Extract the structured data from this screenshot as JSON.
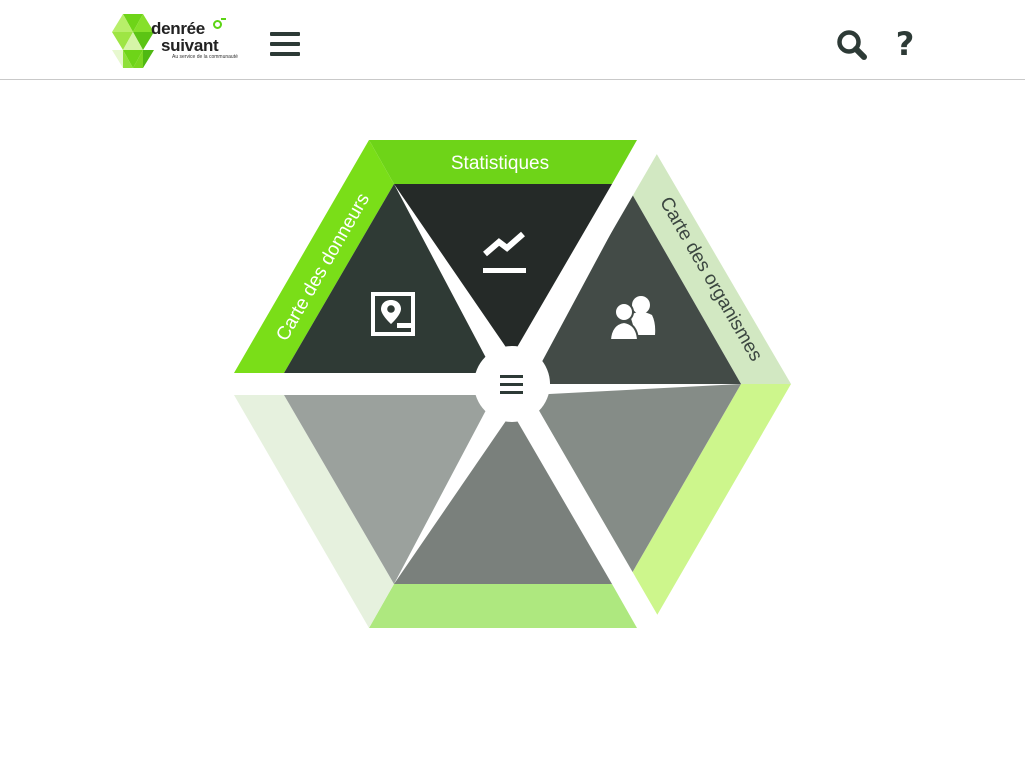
{
  "header": {
    "logo": {
      "word1": "denrée",
      "word2": "suivant",
      "tagline": "Au service de la communauté",
      "brand_color": "#6ed418"
    },
    "menu_icon": "hamburger-icon",
    "search_icon": "search-icon",
    "help_label": "?"
  },
  "hexmenu": {
    "segments": [
      {
        "label": "Statistiques",
        "icon": "line-chart-icon",
        "color": "#252a28",
        "band_color": "#6ed418"
      },
      {
        "label": "Carte des organismes",
        "icon": "users-icon",
        "color": "#434b47",
        "band_color": "#d2e8c2"
      },
      {
        "label": "",
        "icon": "",
        "color": "#858c87",
        "band_color": "#cdf68c"
      },
      {
        "label": "",
        "icon": "",
        "color": "#7a807c",
        "band_color": "#aee87f"
      },
      {
        "label": "",
        "icon": "",
        "color": "#9ba19d",
        "band_color": "#e6f1de"
      },
      {
        "label": "Carte des donneurs",
        "icon": "map-marker-icon",
        "color": "#2f3a35",
        "band_color": "#7ade18"
      }
    ],
    "center_icon": "hamburger-icon"
  }
}
